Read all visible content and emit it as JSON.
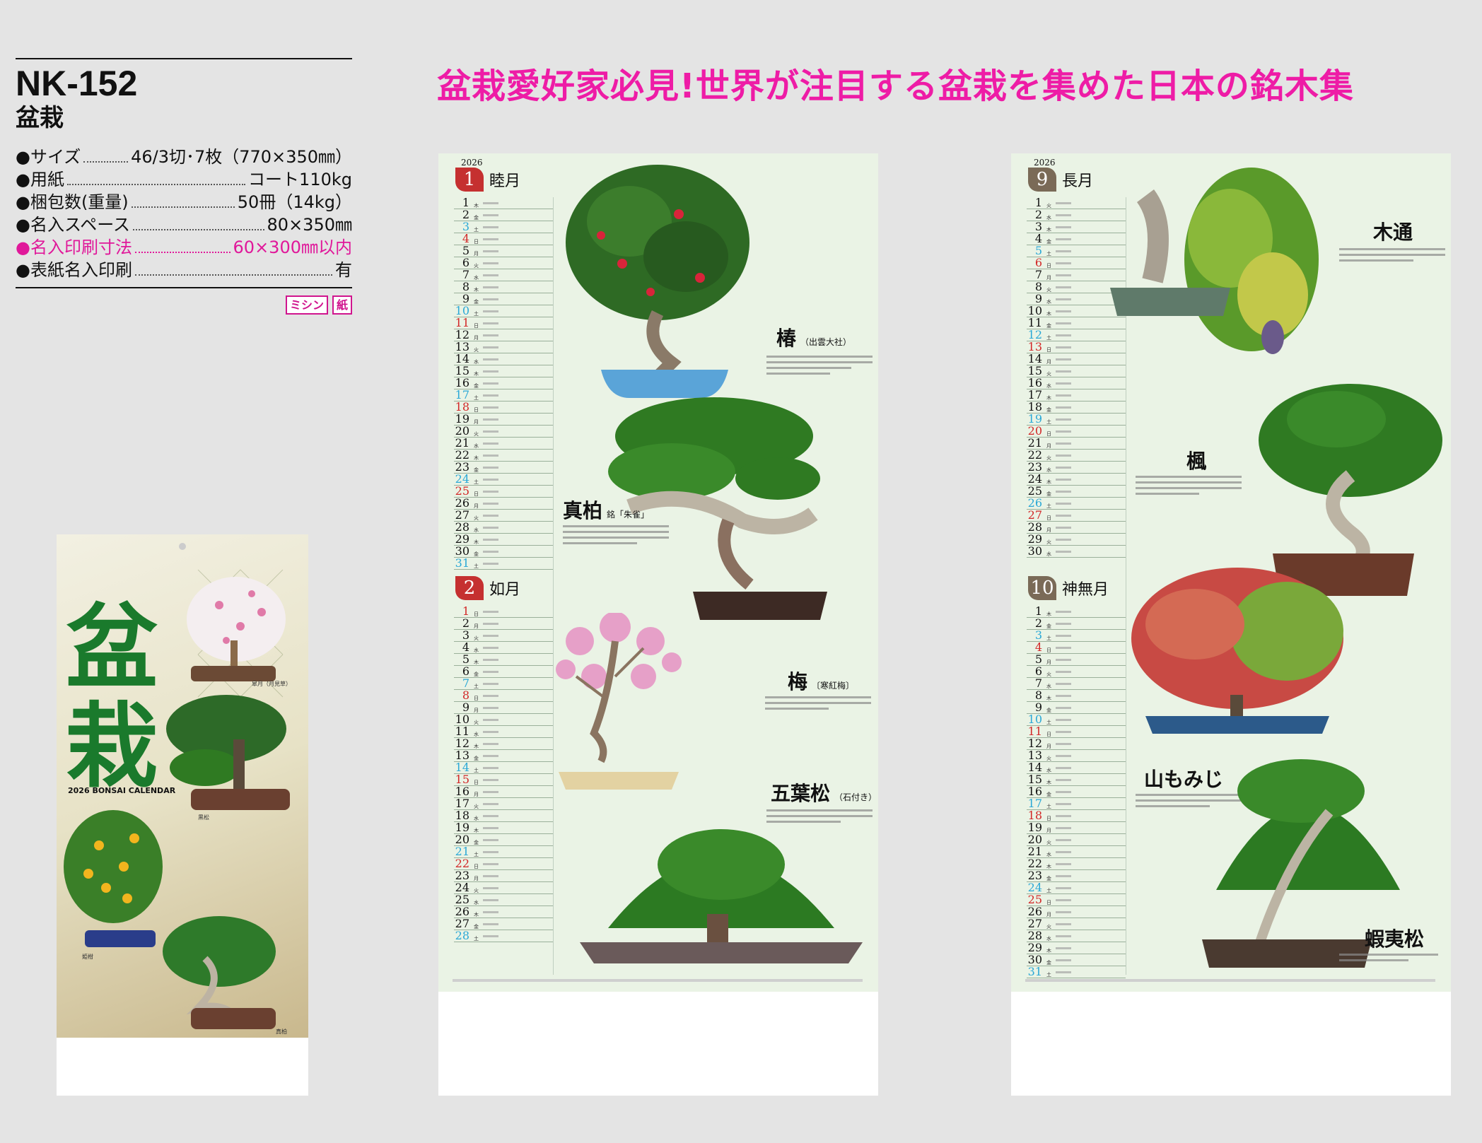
{
  "product": {
    "code": "NK-152",
    "name": "盆栽",
    "specs": [
      {
        "label": "●サイズ",
        "value": "46/3切･7枚（770×350㎜）",
        "highlight": false
      },
      {
        "label": "●用紙",
        "value": "コート110kg",
        "highlight": false
      },
      {
        "label": "●梱包数(重量)",
        "value": "50冊（14kg）",
        "highlight": false
      },
      {
        "label": "●名入スペース",
        "value": "80×350㎜",
        "highlight": false
      },
      {
        "label": "●名入印刷寸法",
        "value": "60×300㎜以内",
        "highlight": true
      },
      {
        "label": "●表紙名入印刷",
        "value": "有",
        "highlight": false
      }
    ],
    "badges": [
      "ミシン",
      "紙"
    ]
  },
  "headline": "盆栽愛好家必見!世界が注目する盆栽を集めた日本の銘木集",
  "cover": {
    "title": "盆栽",
    "subtitle": "2026 BONSAI CALENDAR",
    "labels": [
      "皐月（月見草）",
      "黒松",
      "姫柑",
      "真柏"
    ]
  },
  "colors": {
    "headline": "#ee1ca6",
    "sunday": "#d22727",
    "saturday": "#2aa8d6",
    "leaf": "#2f7a22"
  },
  "pages": [
    {
      "year": "2026",
      "months": [
        {
          "num": "1",
          "name": "睦月"
        },
        {
          "num": "2",
          "name": "如月"
        }
      ],
      "trees": [
        {
          "name": "椿",
          "variety": "（出雲大社）"
        },
        {
          "name": "真柏",
          "variety": "銘「朱雀」"
        },
        {
          "name": "梅",
          "variety": "〔寒紅梅〕"
        },
        {
          "name": "五葉松",
          "variety": "（石付き）"
        }
      ]
    },
    {
      "year": "2026",
      "months": [
        {
          "num": "9",
          "name": "長月"
        },
        {
          "num": "10",
          "name": "神無月"
        }
      ],
      "trees": [
        {
          "name": "木通",
          "variety": ""
        },
        {
          "name": "楓",
          "variety": ""
        },
        {
          "name": "山もみじ",
          "variety": ""
        },
        {
          "name": "蝦夷松",
          "variety": ""
        }
      ]
    }
  ]
}
